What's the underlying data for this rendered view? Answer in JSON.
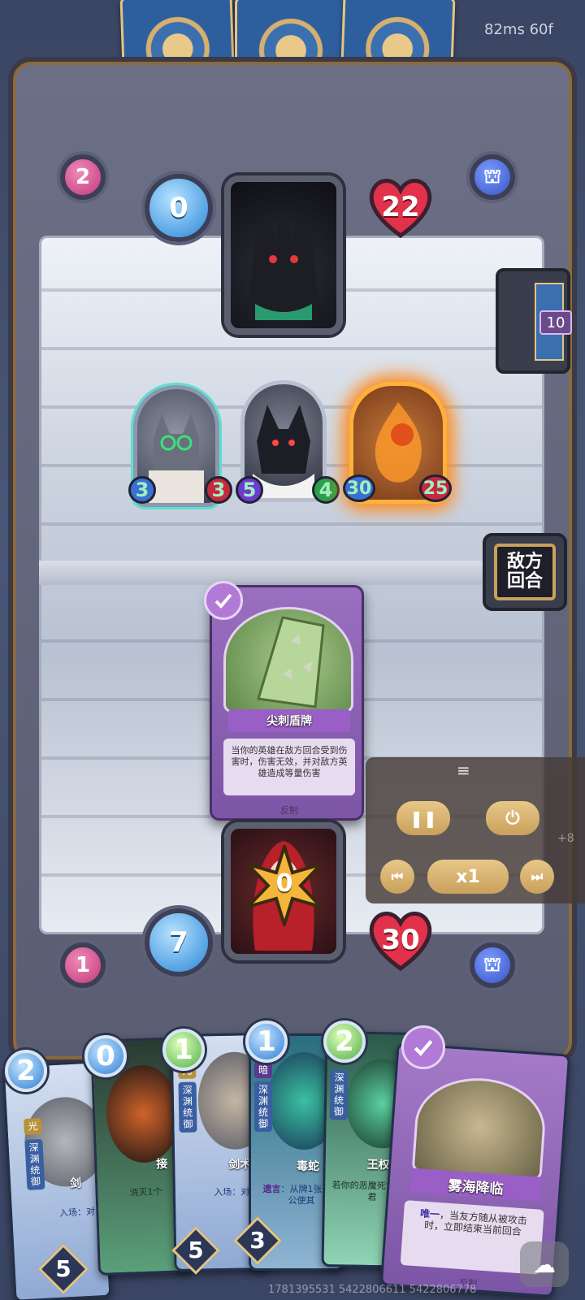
{
  "perf": {
    "latency": "82ms",
    "fps": "60f"
  },
  "enemy": {
    "hand_count": "2",
    "mana": "0",
    "health": "22",
    "deck_count": "10"
  },
  "player": {
    "hand_count": "1",
    "mana": "7",
    "health": "30",
    "hero_value": "0"
  },
  "board": {
    "minions": [
      {
        "attack": "3",
        "health": "3"
      },
      {
        "attack": "5",
        "health": "4"
      },
      {
        "attack": "30",
        "health": "25"
      }
    ]
  },
  "end_turn_button": {
    "label": "敌方回合"
  },
  "played_card": {
    "name": "尖刺盾牌",
    "text": "当你的英雄在敌方回合受到伤害时，伤害无效，并对敌方英雄造成等量伤害",
    "type": "反制"
  },
  "controls": {
    "speed": "x1",
    "drag_hint": "≡",
    "side_text": "+8"
  },
  "hand": [
    {
      "cost": "2",
      "tag": "光",
      "sub": "深渊统御",
      "name": "剑",
      "text": "入场：对",
      "power": "5"
    },
    {
      "cost": "0",
      "name": "接",
      "text": "消灭1个"
    },
    {
      "cost": "1",
      "tag": "光",
      "sub": "深渊统御",
      "name": "剑术",
      "text": "入场：对你",
      "power": "5"
    },
    {
      "cost": "1",
      "tag": "暗",
      "sub": "深渊统御",
      "name": "毒蛇",
      "text_kw": "遗言",
      "text": "：从牌1张恶魔公使其",
      "power": "3"
    },
    {
      "cost": "2",
      "sub": "深渊统御",
      "name": "王权",
      "text": "若你的恶魔死亡，则君"
    },
    {
      "name": "雾海降临",
      "text_kw": "唯一",
      "text": "，当友方随从被攻击时，立即结束当前回合",
      "type": "反制"
    }
  ],
  "footer_id": "1781395531 5422806611 5422806778"
}
